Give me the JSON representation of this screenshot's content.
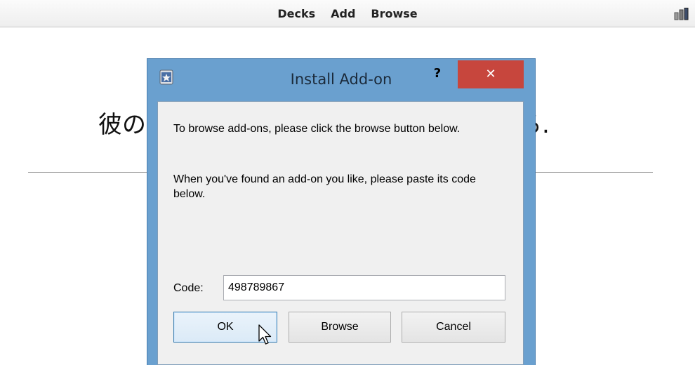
{
  "toolbar": {
    "items": [
      "Decks",
      "Add",
      "Browse"
    ],
    "stats_icon": "bar-chart-icon"
  },
  "card": {
    "text_left": "彼の",
    "text_right": "る."
  },
  "dialog": {
    "title": "Install Add-on",
    "help_label": "?",
    "close_label": "✕",
    "app_icon": "anki-app-icon",
    "paragraph1": "To browse add-ons, please click the browse button below.",
    "paragraph2": "When you've found an add-on you like, please paste its code below.",
    "code_label": "Code:",
    "code_value": "498789867",
    "buttons": {
      "ok": "OK",
      "browse": "Browse",
      "cancel": "Cancel"
    }
  },
  "colors": {
    "frame": "#6aa0cf",
    "close": "#c7463d",
    "ok_border": "#3c7fb1"
  }
}
